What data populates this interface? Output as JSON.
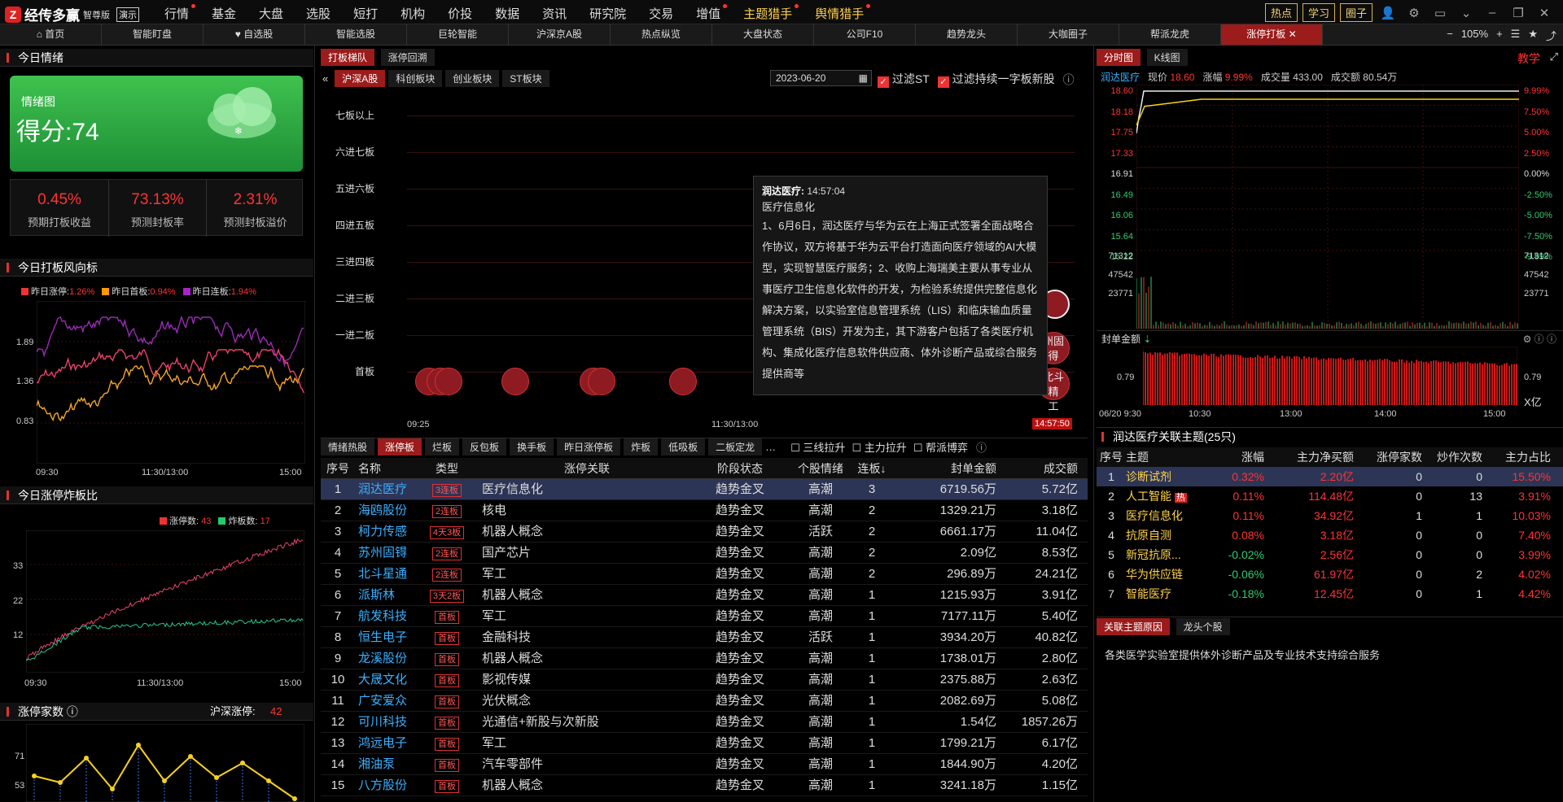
{
  "app": {
    "name": "经传多赢",
    "edition": "智尊版",
    "demo": "演示"
  },
  "menu": [
    "行情",
    "基金",
    "大盘",
    "选股",
    "短打",
    "机构",
    "价投",
    "数据",
    "资讯",
    "研究院",
    "交易",
    "增值",
    "主题猎手",
    "舆情猎手"
  ],
  "top_right": {
    "btn1": "热点",
    "btn2": "学习",
    "btn3": "圈子"
  },
  "tabs": [
    "首页",
    "智能盯盘",
    "自选股",
    "智能选股",
    "巨轮智能",
    "沪深京A股",
    "热点纵览",
    "大盘状态",
    "公司F10",
    "趋势龙头",
    "大咖圈子",
    "帮派龙虎",
    "涨停打板"
  ],
  "zoom": "105%",
  "left": {
    "mood_title": "今日情绪",
    "mood_card": {
      "label": "情绪图",
      "score": "得分:74"
    },
    "stats": [
      {
        "v": "0.45%",
        "l": "预期打板收益"
      },
      {
        "v": "73.13%",
        "l": "预测封板率"
      },
      {
        "v": "2.31%",
        "l": "预测封板溢价"
      }
    ],
    "wind_title": "今日打板风向标",
    "wind_legend": [
      {
        "n": "昨日涨停:",
        "v": "1.26%",
        "c": "#e33"
      },
      {
        "n": "昨日首板:",
        "v": "0.94%",
        "c": "#f90"
      },
      {
        "n": "昨日连板:",
        "v": "1.94%",
        "c": "#a2c"
      }
    ],
    "wind_y": [
      "1.89",
      "1.36",
      "0.83"
    ],
    "wind_x": [
      "09:30",
      "11:30/13:00",
      "15:00"
    ],
    "ratio_title": "今日涨停炸板比",
    "ratio_legend": [
      {
        "n": "涨停数:",
        "v": "43",
        "c": "#e33"
      },
      {
        "n": "炸板数:",
        "v": "17",
        "c": "#2c6"
      }
    ],
    "ratio_y": [
      "33",
      "22",
      "12"
    ],
    "ratio_x": [
      "09:30",
      "11:30/13:00",
      "15:00"
    ],
    "count_title": "涨停家数",
    "count_right": "沪深涨停:",
    "count_right_val": "42",
    "count_y": [
      "71",
      "53"
    ]
  },
  "middle": {
    "tabs_top": [
      "打板梯队",
      "涨停回溯"
    ],
    "market_tabs": [
      "沪深A股",
      "科创板块",
      "创业板块",
      "ST板块"
    ],
    "date": "2023-06-20",
    "filter1": "过滤ST",
    "filter2": "过滤持续一字板新股",
    "ladder_labels": [
      "七板以上",
      "六进七板",
      "五进六板",
      "四进五板",
      "三进四板",
      "二进三板",
      "一进二板",
      "首板"
    ],
    "ladder_x": [
      "09:25",
      "11:30/13:00",
      "14:57:50"
    ],
    "tooltip": {
      "name": "润达医疗:",
      "time": "14:57:04",
      "sector": "医疗信息化",
      "text": "1、6月6日，润达医疗与华为云在上海正式签署全面战略合作协议，双方将基于华为云平台打造面向医疗领域的AI大模型，实现智慧医疗服务；2、收购上海瑞美主要从事专业从事医疗卫生信息化软件的开发，为检验系统提供完整信息化解决方案，以实验室信息管理系统（LIS）和临床输血质量管理系统（BIS）开发为主，其下游客户包括了各类医疗机构、集成化医疗信息软件供应商、体外诊断产品或综合服务提供商等"
    },
    "bubble_peek": [
      "州固",
      "得",
      "北斗精",
      "工"
    ],
    "list_tabs": [
      "情绪热股",
      "涨停板",
      "烂板",
      "反包板",
      "换手板",
      "昨日涨停板",
      "炸板",
      "低吸板",
      "二板定龙",
      "…"
    ],
    "list_checks": [
      "三线拉升",
      "主力拉升",
      "帮派博弈"
    ],
    "table_headers": [
      "序号",
      "名称",
      "类型",
      "涨停关联",
      "阶段状态",
      "个股情绪",
      "连板↓",
      "封单金额",
      "成交额"
    ],
    "rows": [
      [
        "1",
        "润达医疗",
        "3连板",
        "医疗信息化",
        "趋势金叉",
        "高潮",
        "3",
        "6719.56万",
        "5.72亿"
      ],
      [
        "2",
        "海鸥股份",
        "2连板",
        "核电",
        "趋势金叉",
        "高潮",
        "2",
        "1329.21万",
        "3.18亿"
      ],
      [
        "3",
        "柯力传感",
        "4天3板",
        "机器人概念",
        "趋势金叉",
        "活跃",
        "2",
        "6661.17万",
        "11.04亿"
      ],
      [
        "4",
        "苏州固锝",
        "2连板",
        "国产芯片",
        "趋势金叉",
        "高潮",
        "2",
        "2.09亿",
        "8.53亿"
      ],
      [
        "5",
        "北斗星通",
        "2连板",
        "军工",
        "趋势金叉",
        "高潮",
        "2",
        "296.89万",
        "24.21亿"
      ],
      [
        "6",
        "派斯林",
        "3天2板",
        "机器人概念",
        "趋势金叉",
        "高潮",
        "1",
        "1215.93万",
        "3.91亿"
      ],
      [
        "7",
        "航发科技",
        "首板",
        "军工",
        "趋势金叉",
        "高潮",
        "1",
        "7177.11万",
        "5.40亿"
      ],
      [
        "8",
        "恒生电子",
        "首板",
        "金融科技",
        "趋势金叉",
        "活跃",
        "1",
        "3934.20万",
        "40.82亿"
      ],
      [
        "9",
        "龙溪股份",
        "首板",
        "机器人概念",
        "趋势金叉",
        "高潮",
        "1",
        "1738.01万",
        "2.80亿"
      ],
      [
        "10",
        "大晟文化",
        "首板",
        "影视传媒",
        "趋势金叉",
        "高潮",
        "1",
        "2375.88万",
        "2.63亿"
      ],
      [
        "11",
        "广安爱众",
        "首板",
        "光伏概念",
        "趋势金叉",
        "高潮",
        "1",
        "2082.69万",
        "5.08亿"
      ],
      [
        "12",
        "可川科技",
        "首板",
        "光通信+新股与次新股",
        "趋势金叉",
        "高潮",
        "1",
        "1.54亿",
        "1857.26万"
      ],
      [
        "13",
        "鸿远电子",
        "首板",
        "军工",
        "趋势金叉",
        "高潮",
        "1",
        "1799.21万",
        "6.17亿"
      ],
      [
        "14",
        "湘油泵",
        "首板",
        "汽车零部件",
        "趋势金叉",
        "高潮",
        "1",
        "1844.90万",
        "4.20亿"
      ],
      [
        "15",
        "八方股份",
        "首板",
        "机器人概念",
        "趋势金叉",
        "高潮",
        "1",
        "3241.18万",
        "1.15亿"
      ]
    ]
  },
  "right": {
    "tabs": [
      "分时图",
      "K线图"
    ],
    "teach": "教学",
    "quote": {
      "name": "润达医疗",
      "price_l": "现价",
      "price": "18.60",
      "chg_l": "涨幅",
      "chg": "9.99%",
      "vol_l": "成交量",
      "vol": "433.00",
      "amt_l": "成交额",
      "amt": "80.54万"
    },
    "y_left": [
      "18.60",
      "18.18",
      "17.75",
      "17.33",
      "16.91",
      "16.49",
      "16.06",
      "15.64",
      "15.22",
      "71312",
      "47542",
      "23771"
    ],
    "y_right": [
      "9.99%",
      "7.50%",
      "5.00%",
      "2.50%",
      "0.00%",
      "-2.50%",
      "-5.00%",
      "-7.50%",
      "-9.99%",
      "71312",
      "47542",
      "23771"
    ],
    "seal_title": "封单金额",
    "seal_y": "0.79",
    "seal_unit": "X亿",
    "seal_x": [
      "06/20 9:30",
      "10:30",
      "13:00",
      "14:00",
      "15:00"
    ],
    "theme_title": "润达医疗关联主题(25只)",
    "theme_headers": [
      "序号",
      "主题",
      "涨幅",
      "主力净买额",
      "涨停家数",
      "炒作次数",
      "主力占比"
    ],
    "themes": [
      [
        "1",
        "诊断试剂",
        "0.32%",
        "2.20亿",
        "0",
        "0",
        "15.50%"
      ],
      [
        "2",
        "人工智能",
        "0.11%",
        "114.48亿",
        "0",
        "13",
        "3.91%"
      ],
      [
        "3",
        "医疗信息化",
        "0.11%",
        "34.92亿",
        "1",
        "1",
        "10.03%"
      ],
      [
        "4",
        "抗原自测",
        "0.08%",
        "3.18亿",
        "0",
        "0",
        "7.40%"
      ],
      [
        "5",
        "新冠抗原...",
        "-0.02%",
        "2.56亿",
        "0",
        "0",
        "3.99%"
      ],
      [
        "6",
        "华为供应链",
        "-0.06%",
        "61.97亿",
        "0",
        "2",
        "4.02%"
      ],
      [
        "7",
        "智能医疗",
        "-0.18%",
        "12.45亿",
        "0",
        "1",
        "4.42%"
      ]
    ],
    "hot_badge": "热",
    "bottom_tabs": [
      "关联主题原因",
      "龙头个股"
    ],
    "reason": "各类医学实验室提供体外诊断产品及专业技术支持综合服务"
  }
}
